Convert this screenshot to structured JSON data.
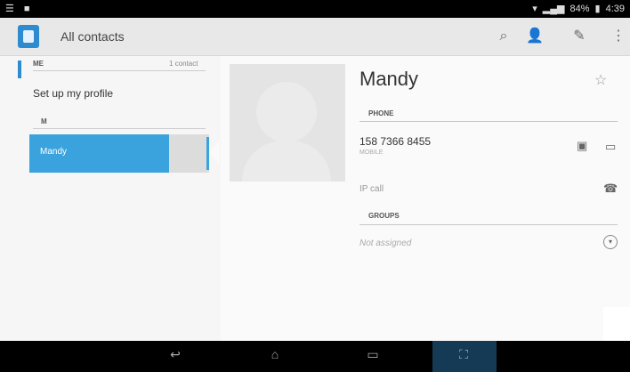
{
  "statusbar": {
    "left_icons": "☰ ■",
    "battery_text": "84%",
    "time": "4:39"
  },
  "actionbar": {
    "title": "All contacts"
  },
  "left_pane": {
    "me_header": "ME",
    "me_count": "1 contact",
    "setup_profile": "Set up my profile",
    "section_m": "M",
    "selected_contact": "Mandy"
  },
  "contact": {
    "name": "Mandy",
    "phone_header": "PHONE",
    "phone_number": "158 7366 8455",
    "phone_type": "MOBILE",
    "ip_call": "IP call",
    "groups_header": "GROUPS",
    "groups_value": "Not assigned"
  }
}
